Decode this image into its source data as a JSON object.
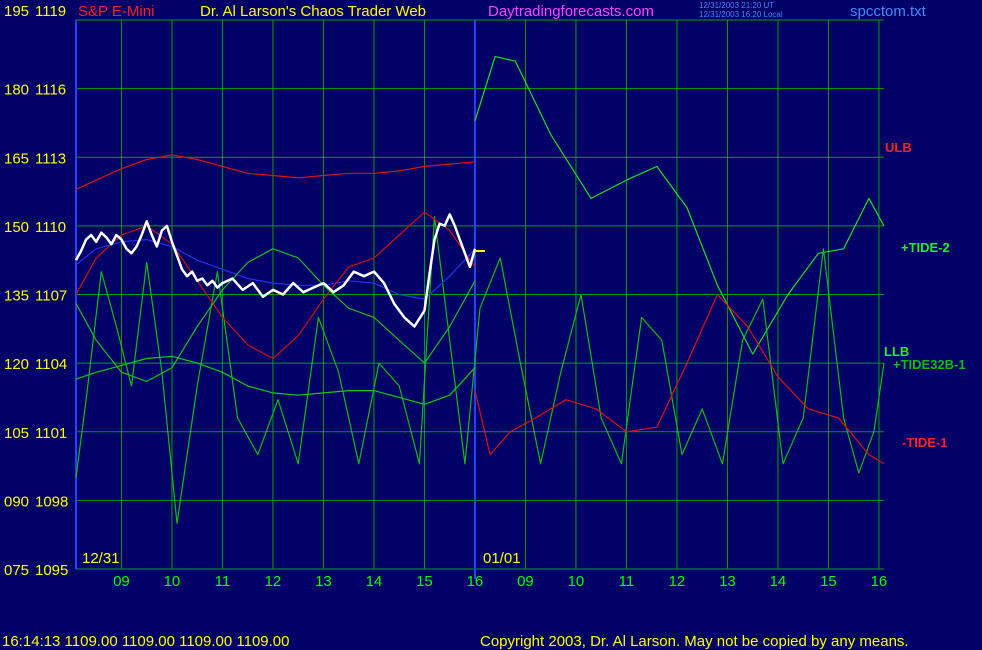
{
  "header": {
    "title_left": "S&P E-Mini",
    "title_center": "Dr. Al Larson's Chaos Trader Web",
    "site": "Daytradingforecasts.com",
    "stamp_line1": "12/31/2003 21:20 UT",
    "stamp_line2": "12/31/2003 16:20 Local",
    "filename": "spcctom.txt"
  },
  "footer": {
    "status": "16:14:13  1109.00 1109.00 1109.00 1109.00",
    "copyright": "Copyright 2003, Dr. Al Larson. May not be copied by any means."
  },
  "colors": {
    "background": "#000066",
    "grid": "#00a000",
    "axis_text": "#ffff00",
    "hour_text": "#00ff00",
    "title_red": "#ff2020",
    "site_magenta": "#ff44ff",
    "filename_blue": "#4488ff",
    "divider_blue": "#2244ff"
  },
  "chart_data": {
    "type": "line",
    "title": "S&P E-Mini",
    "y_left_labels": [
      "195",
      "180",
      "165",
      "150",
      "135",
      "120",
      "105",
      "090",
      "075"
    ],
    "y_right_labels": [
      "1119",
      "1116",
      "1113",
      "1110",
      "1107",
      "1104",
      "1101",
      "1098",
      "1095"
    ],
    "ylim_price": [
      1095,
      1119
    ],
    "ylim_osc": [
      75,
      195
    ],
    "x_hours": [
      "09",
      "10",
      "11",
      "12",
      "13",
      "14",
      "15",
      "16",
      "09",
      "10",
      "11",
      "12",
      "13",
      "14",
      "15",
      "16"
    ],
    "date_labels": [
      "12/31",
      "01/01"
    ],
    "xlim": [
      8.1,
      24.1
    ],
    "day_divider_x": 16.0,
    "series_labels": {
      "ulb": "ULB",
      "tide2": "+TIDE-2",
      "llb": "LLB",
      "tide32": "+TIDE32B-1",
      "tide1": "-TIDE-1"
    },
    "series": [
      {
        "name": "ULB",
        "color": "#dd1111",
        "x": [
          8.1,
          8.5,
          9,
          9.5,
          10,
          10.5,
          11,
          11.5,
          12,
          12.5,
          13,
          13.5,
          14,
          14.5,
          15,
          15.5,
          16
        ],
        "values": [
          1111.6,
          1112.0,
          1112.5,
          1112.9,
          1113.1,
          1112.9,
          1112.6,
          1112.3,
          1112.2,
          1112.1,
          1112.2,
          1112.3,
          1112.3,
          1112.4,
          1112.6,
          1112.7,
          1112.8
        ]
      },
      {
        "name": "LLB",
        "color": "#11cc11",
        "x": [
          8.1,
          8.5,
          9,
          9.5,
          10,
          10.5,
          11,
          11.5,
          12,
          12.5,
          13,
          13.5,
          14,
          14.5,
          15,
          15.5,
          16
        ],
        "values": [
          1103.3,
          1103.6,
          1103.9,
          1104.2,
          1104.3,
          1104.0,
          1103.6,
          1103.0,
          1102.7,
          1102.6,
          1102.7,
          1102.8,
          1102.8,
          1102.5,
          1102.2,
          1102.6,
          1103.8
        ]
      },
      {
        "name": "+TIDE-2",
        "color": "#22dd22",
        "x": [
          16,
          16.4,
          16.8,
          17.5,
          18.3,
          19.0,
          19.6,
          20.2,
          20.8,
          21.5,
          22.2,
          22.8,
          23.3,
          23.8,
          24.1
        ],
        "values": [
          173,
          187,
          186,
          170,
          156,
          160,
          163,
          154,
          137,
          122,
          135,
          144,
          145,
          156,
          150
        ]
      },
      {
        "name": "+TIDE32B-1",
        "color": "#11bb11",
        "x": [
          8.1,
          8.3,
          8.6,
          8.9,
          9.2,
          9.5,
          9.8,
          10.1,
          10.5,
          10.9,
          11.3,
          11.7,
          12.1,
          12.5,
          12.9,
          13.3,
          13.7,
          14.1,
          14.5,
          14.9,
          15.2,
          15.5,
          15.8,
          16.1,
          16.5,
          16.9,
          17.3,
          17.7,
          18.1,
          18.5,
          18.9,
          19.3,
          19.7,
          20.1,
          20.5,
          20.9,
          21.3,
          21.7,
          22.1,
          22.5,
          22.9,
          23.3,
          23.6,
          23.9,
          24.1
        ],
        "values": [
          95,
          112,
          140,
          128,
          115,
          142,
          118,
          85,
          115,
          140,
          108,
          100,
          112,
          98,
          130,
          118,
          98,
          120,
          115,
          98,
          152,
          125,
          98,
          132,
          143,
          120,
          98,
          118,
          135,
          108,
          98,
          130,
          125,
          100,
          110,
          98,
          125,
          134,
          98,
          108,
          145,
          108,
          96,
          105,
          120
        ]
      },
      {
        "name": "-TIDE-1",
        "color": "#dd1111",
        "x": [
          16,
          16.3,
          16.7,
          17.2,
          17.8,
          18.4,
          19.0,
          19.6,
          20.2,
          20.8,
          21.4,
          22.0,
          22.6,
          23.2,
          23.8,
          24.1
        ],
        "values": [
          114,
          100,
          105,
          108,
          112,
          110,
          105,
          106,
          120,
          135,
          128,
          117,
          110,
          108,
          100,
          98
        ]
      },
      {
        "name": "Avg",
        "color": "#2233ee",
        "x": [
          8.1,
          8.5,
          9,
          9.5,
          10,
          10.5,
          11,
          11.5,
          12,
          12.5,
          13,
          13.5,
          14,
          14.5,
          15,
          15.5,
          16
        ],
        "values": [
          1108.3,
          1109.0,
          1109.3,
          1109.4,
          1109.1,
          1108.5,
          1108.1,
          1107.7,
          1107.5,
          1107.4,
          1107.4,
          1107.6,
          1107.5,
          1107.0,
          1106.8,
          1107.8,
          1109.0
        ]
      },
      {
        "name": "Osc1",
        "color": "#cc1111",
        "x": [
          8.1,
          8.5,
          9,
          9.5,
          10,
          10.5,
          11,
          11.5,
          12,
          12.5,
          13,
          13.5,
          14,
          14.5,
          15,
          15.5,
          16
        ],
        "values": [
          135,
          143,
          148,
          150,
          146,
          138,
          130,
          124,
          121,
          126,
          134,
          141,
          143,
          148,
          153,
          149,
          141
        ]
      },
      {
        "name": "Osc2",
        "color": "#22bb22",
        "x": [
          8.1,
          8.5,
          9,
          9.5,
          10,
          10.5,
          11,
          11.5,
          12,
          12.5,
          13,
          13.5,
          14,
          14.5,
          15,
          15.5,
          16
        ],
        "values": [
          133,
          125,
          118,
          116,
          119,
          128,
          136,
          142,
          145,
          143,
          137,
          132,
          130,
          125,
          120,
          128,
          138
        ]
      },
      {
        "name": "Price",
        "color": "#ffffff",
        "x": [
          8.1,
          8.2,
          8.3,
          8.4,
          8.5,
          8.6,
          8.7,
          8.8,
          8.9,
          9.0,
          9.1,
          9.2,
          9.3,
          9.4,
          9.5,
          9.6,
          9.7,
          9.8,
          9.9,
          10.0,
          10.1,
          10.2,
          10.3,
          10.4,
          10.5,
          10.6,
          10.7,
          10.8,
          10.9,
          11.0,
          11.2,
          11.4,
          11.6,
          11.8,
          12.0,
          12.2,
          12.4,
          12.6,
          12.8,
          13.0,
          13.2,
          13.4,
          13.6,
          13.8,
          14.0,
          14.2,
          14.4,
          14.6,
          14.8,
          15.0,
          15.1,
          15.2,
          15.3,
          15.4,
          15.5,
          15.6,
          15.7,
          15.8,
          15.9,
          16.0
        ],
        "values": [
          1108.5,
          1108.9,
          1109.4,
          1109.6,
          1109.3,
          1109.7,
          1109.5,
          1109.2,
          1109.6,
          1109.4,
          1109.0,
          1108.8,
          1109.1,
          1109.6,
          1110.2,
          1109.6,
          1109.1,
          1109.8,
          1110.0,
          1109.3,
          1108.7,
          1108.1,
          1107.8,
          1108.0,
          1107.6,
          1107.7,
          1107.4,
          1107.6,
          1107.3,
          1107.5,
          1107.7,
          1107.2,
          1107.5,
          1106.9,
          1107.2,
          1107.0,
          1107.5,
          1107.1,
          1107.3,
          1107.5,
          1107.1,
          1107.4,
          1108.0,
          1107.8,
          1108.0,
          1107.5,
          1106.6,
          1106.0,
          1105.6,
          1106.3,
          1107.9,
          1109.4,
          1110.1,
          1110.0,
          1110.5,
          1110.0,
          1109.4,
          1108.8,
          1108.2,
          1109.0
        ]
      },
      {
        "name": "Last",
        "color": "#ffff00",
        "x": [
          16.0,
          16.2
        ],
        "values": [
          1108.9,
          1108.9
        ]
      }
    ]
  }
}
